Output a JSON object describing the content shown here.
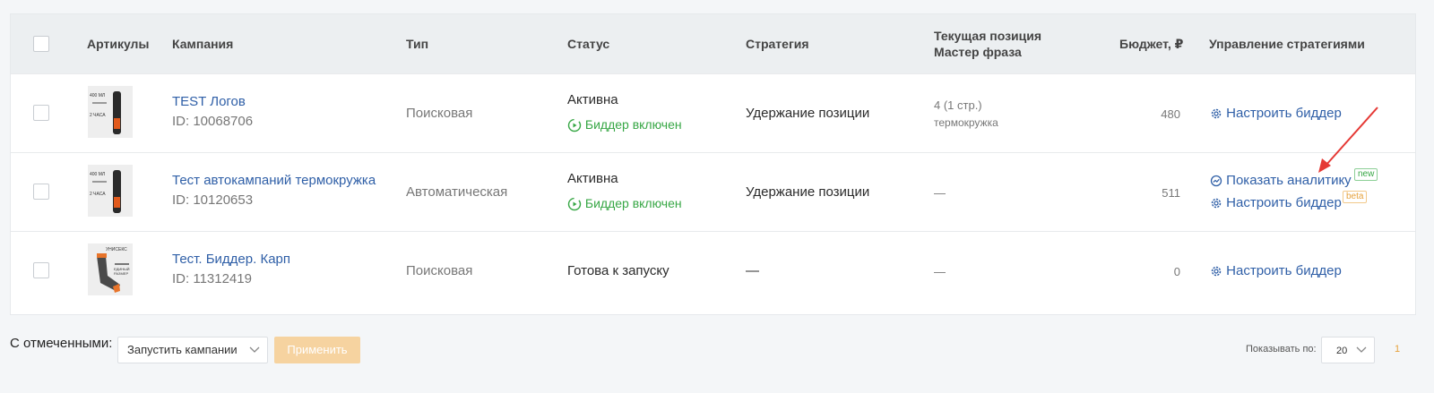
{
  "table": {
    "headers": {
      "articles": "Артикулы",
      "campaign": "Кампания",
      "type": "Тип",
      "status": "Статус",
      "strategy": "Стратегия",
      "position_line1": "Текущая позиция",
      "position_line2": "Мастер фраза",
      "budget": "Бюджет, ₽",
      "manage": "Управление стратегиями"
    },
    "rows": [
      {
        "thumb_text_top": "400 МЛ",
        "thumb_text_bottom": "2 ЧАСА",
        "name": "TEST Логов",
        "id": "ID: 10068706",
        "type": "Поисковая",
        "status": "Активна",
        "bidder": "Биддер включен",
        "strategy": "Удержание позиции",
        "position": "4 (1 стр.)",
        "phrase": "термокружка",
        "budget": "480",
        "action1": "Настроить биддер"
      },
      {
        "thumb_text_top": "400 МЛ",
        "thumb_text_bottom": "2 ЧАСА",
        "name": "Тест автокампаний термокружка",
        "id": "ID: 10120653",
        "type": "Автоматическая",
        "status": "Активна",
        "bidder": "Биддер включен",
        "strategy": "Удержание позиции",
        "position": "—",
        "budget": "511",
        "action1": "Показать аналитику",
        "action1_tag": "new",
        "action2": "Настроить биддер",
        "action2_tag": "beta"
      },
      {
        "thumb_text_top": "УНИСЕКС",
        "thumb_text_bottom": "ЕДИНЫЙ РАЗМЕР",
        "name": "Тест. Биддер. Карп",
        "id": "ID: 11312419",
        "type": "Поисковая",
        "status": "Готова к запуску",
        "strategy": "—",
        "position": "—",
        "budget": "0",
        "action1": "Настроить биддер"
      }
    ]
  },
  "footer": {
    "with_selected_label": "С отмеченными:",
    "bulk_action_value": "Запустить кампании",
    "apply_label": "Применить",
    "per_page_label": "Показывать по:",
    "per_page_value": "20",
    "current_page": "1"
  },
  "colors": {
    "link": "#2f5fa7",
    "green": "#37a745",
    "arrow": "#e53935",
    "apply": "#f6d3a0",
    "page": "#e6a23c"
  }
}
